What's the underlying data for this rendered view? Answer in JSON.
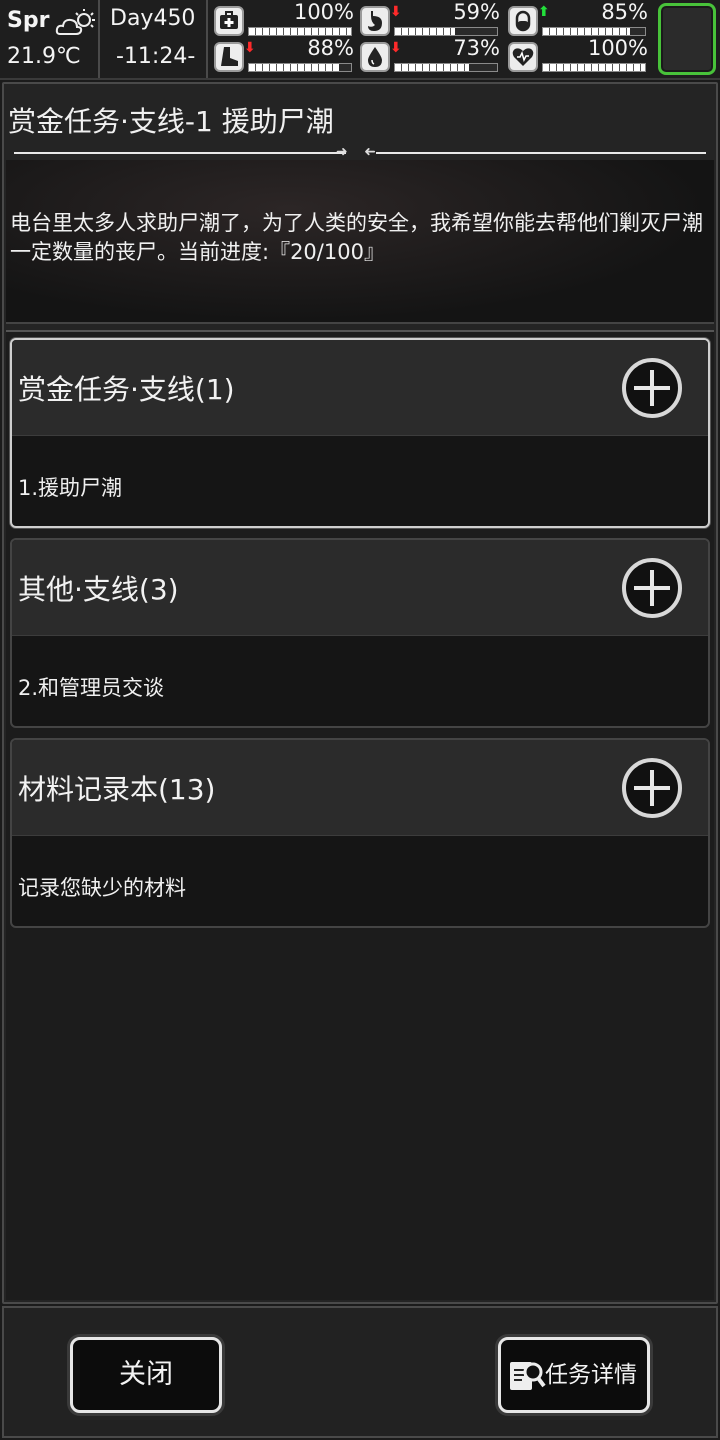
{
  "status": {
    "season": "Spr",
    "weather_icon": "partly-cloudy-sun-icon",
    "temperature": "21.9℃",
    "day": "Day450",
    "time": "-11:24-",
    "stats": [
      {
        "name": "health",
        "icon": "medkit-icon",
        "trend": "",
        "value": "100%",
        "level": 1.0
      },
      {
        "name": "hunger",
        "icon": "stomach-icon",
        "trend": "down",
        "value": "59%",
        "level": 0.59
      },
      {
        "name": "medicine",
        "icon": "pill-icon",
        "trend": "up",
        "value": "85%",
        "level": 0.85
      },
      {
        "name": "stamina",
        "icon": "boot-icon",
        "trend": "down",
        "value": "88%",
        "level": 0.88
      },
      {
        "name": "thirst",
        "icon": "water-drop-icon",
        "trend": "down",
        "value": "73%",
        "level": 0.73
      },
      {
        "name": "mood",
        "icon": "heart-icon",
        "trend": "",
        "value": "100%",
        "level": 1.0
      }
    ],
    "slot_color": "#48c23a"
  },
  "quest": {
    "title": "赏金任务·支线-1 援助尸潮",
    "description": "电台里太多人求助尸潮了，为了人类的安全，我希望你能去帮他们剿灭尸潮一定数量的丧尸。当前进度:『20/100』"
  },
  "categories": [
    {
      "label": "赏金任务·支线(1)",
      "item": "1.援助尸潮",
      "selected": true
    },
    {
      "label": "其他·支线(3)",
      "item": "2.和管理员交谈",
      "selected": false
    },
    {
      "label": "材料记录本(13)",
      "item": "记录您缺少的材料",
      "selected": false
    }
  ],
  "buttons": {
    "close": "关闭",
    "details": "任务详情"
  }
}
